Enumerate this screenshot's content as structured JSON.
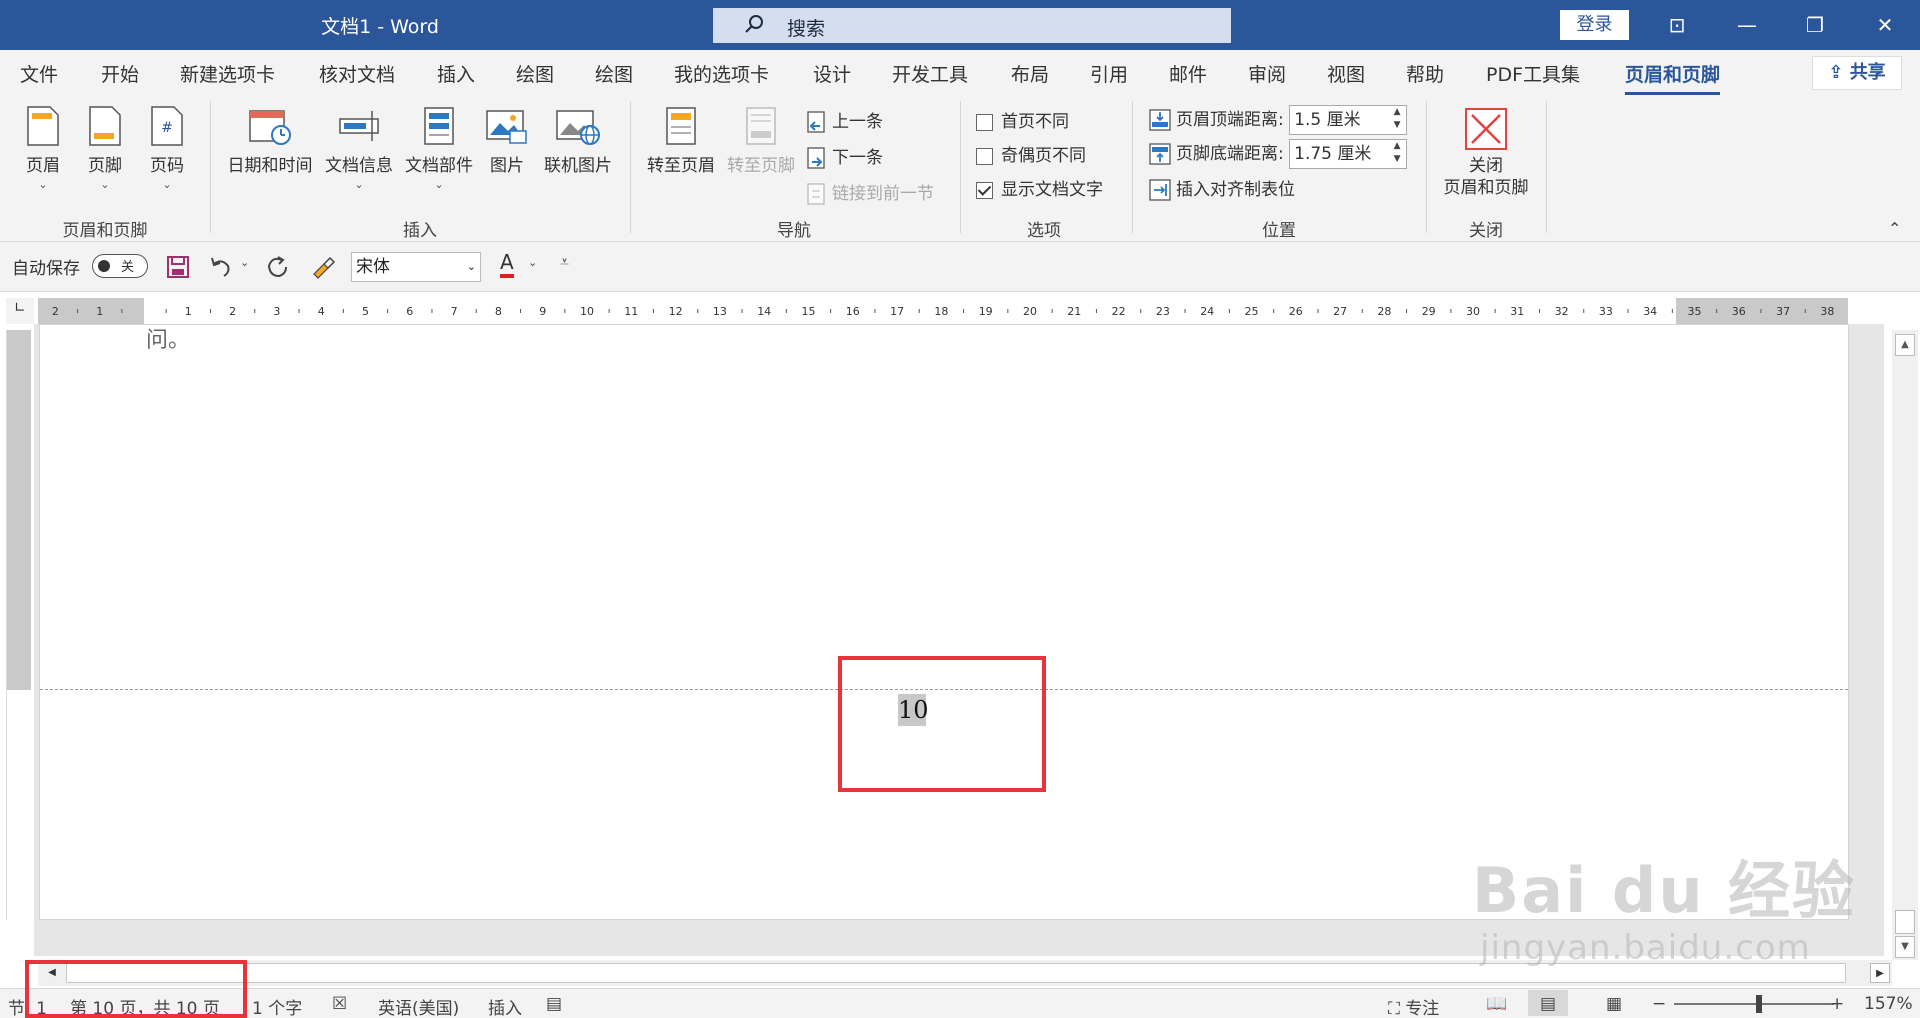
{
  "window": {
    "title": "文档1  -  Word",
    "search_label": "搜索",
    "login_label": "登录",
    "controls": {
      "ribbon_display": "⊡",
      "minimize": "—",
      "restore": "❐",
      "close": "✕"
    }
  },
  "tabs": [
    {
      "label": "文件"
    },
    {
      "label": "开始"
    },
    {
      "label": "新建选项卡"
    },
    {
      "label": "核对文档"
    },
    {
      "label": "插入"
    },
    {
      "label": "绘图"
    },
    {
      "label": "绘图"
    },
    {
      "label": "我的选项卡"
    },
    {
      "label": "设计"
    },
    {
      "label": "开发工具"
    },
    {
      "label": "布局"
    },
    {
      "label": "引用"
    },
    {
      "label": "邮件"
    },
    {
      "label": "审阅"
    },
    {
      "label": "视图"
    },
    {
      "label": "帮助"
    },
    {
      "label": "PDF工具集"
    },
    {
      "label": "页眉和页脚",
      "active": true
    }
  ],
  "share_label": "共享",
  "ribbon": {
    "group_header_footer": {
      "label": "页眉和页脚",
      "header": "页眉",
      "footer": "页脚",
      "page_number": "页码"
    },
    "group_insert": {
      "label": "插入",
      "date_time": "日期和时间",
      "doc_info": "文档信息",
      "doc_parts": "文档部件",
      "picture": "图片",
      "online_picture": "联机图片"
    },
    "group_navigation": {
      "label": "导航",
      "goto_header": "转至页眉",
      "goto_footer": "转至页脚",
      "previous": "上一条",
      "next": "下一条",
      "link_previous": "链接到前一节"
    },
    "group_options": {
      "label": "选项",
      "different_first": "首页不同",
      "different_odd_even": "奇偶页不同",
      "show_doc_text": "显示文档文字",
      "different_first_checked": false,
      "different_odd_even_checked": false,
      "show_doc_text_checked": true
    },
    "group_position": {
      "label": "位置",
      "header_top_label": "页眉顶端距离:",
      "header_top_value": "1.5 厘米",
      "footer_bottom_label": "页脚底端距离:",
      "footer_bottom_value": "1.75 厘米",
      "insert_align_tab": "插入对齐制表位"
    },
    "group_close": {
      "label": "关闭",
      "close_line1": "关闭",
      "close_line2": "页眉和页脚"
    }
  },
  "qat": {
    "autosave_label": "自动保存",
    "autosave_state": "关",
    "font_name": "宋体",
    "font_color_letter": "A"
  },
  "ruler": {
    "left_labels": [
      "2",
      "1"
    ],
    "labels": [
      "1",
      "2",
      "3",
      "4",
      "5",
      "6",
      "7",
      "8",
      "9",
      "10",
      "11",
      "12",
      "13",
      "14",
      "15",
      "16",
      "17",
      "18",
      "19",
      "20",
      "21",
      "22",
      "23",
      "24",
      "25",
      "26",
      "27",
      "28",
      "29",
      "30",
      "31",
      "32",
      "33",
      "34",
      "35",
      "36",
      "37",
      "38"
    ]
  },
  "document": {
    "top_fragment": "问。",
    "footer_page_number": "10"
  },
  "status": {
    "section": "节: 1",
    "page": "第 10 页，共 10 页",
    "words": "1 个字",
    "language": "英语(美国)",
    "insert_mode": "插入",
    "focus": "专注",
    "zoom": "157%",
    "zoom_minus": "−",
    "zoom_plus": "+",
    "zoom_level": 1.57
  },
  "watermark": {
    "brand": "Bai du 经验",
    "url": "jingyan.baidu.com"
  },
  "colors": {
    "titlebar": "#2b579a",
    "accent": "#2b579a",
    "highlight_box": "#e8333a"
  }
}
